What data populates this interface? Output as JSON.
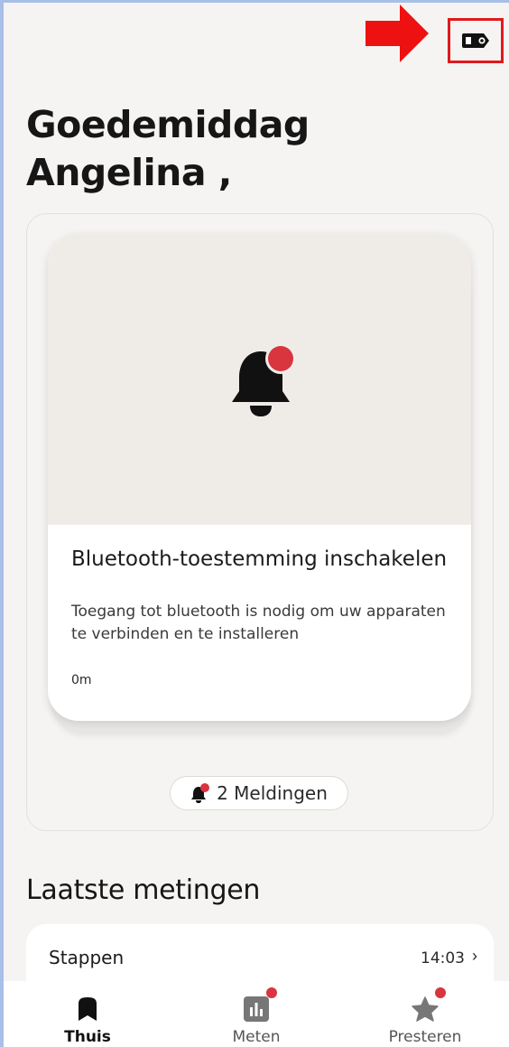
{
  "header": {
    "greeting_line1": "Goedemiddag",
    "greeting_line2": "Angelina ,",
    "device_icon": "watch-device-icon",
    "annotation_color": "#e0191e"
  },
  "notification_card": {
    "icon": "bell-icon",
    "title": "Bluetooth-toestemming inschakelen",
    "description": "Toegang tot bluetooth is nodig om uw apparaten te verbinden en te installeren",
    "time": "0m",
    "accent_color": "#d8353f"
  },
  "notifications_pill": {
    "label": "2 Meldingen"
  },
  "latest": {
    "title": "Laatste metingen",
    "steps_label": "Stappen",
    "steps_time": "14:03"
  },
  "bottom_nav": {
    "items": [
      {
        "label": "Thuis",
        "icon": "home-bookmark-icon",
        "active": true
      },
      {
        "label": "Meten",
        "icon": "bar-chart-icon",
        "badge": true
      },
      {
        "label": "Presteren",
        "icon": "star-icon",
        "badge": true
      }
    ]
  }
}
